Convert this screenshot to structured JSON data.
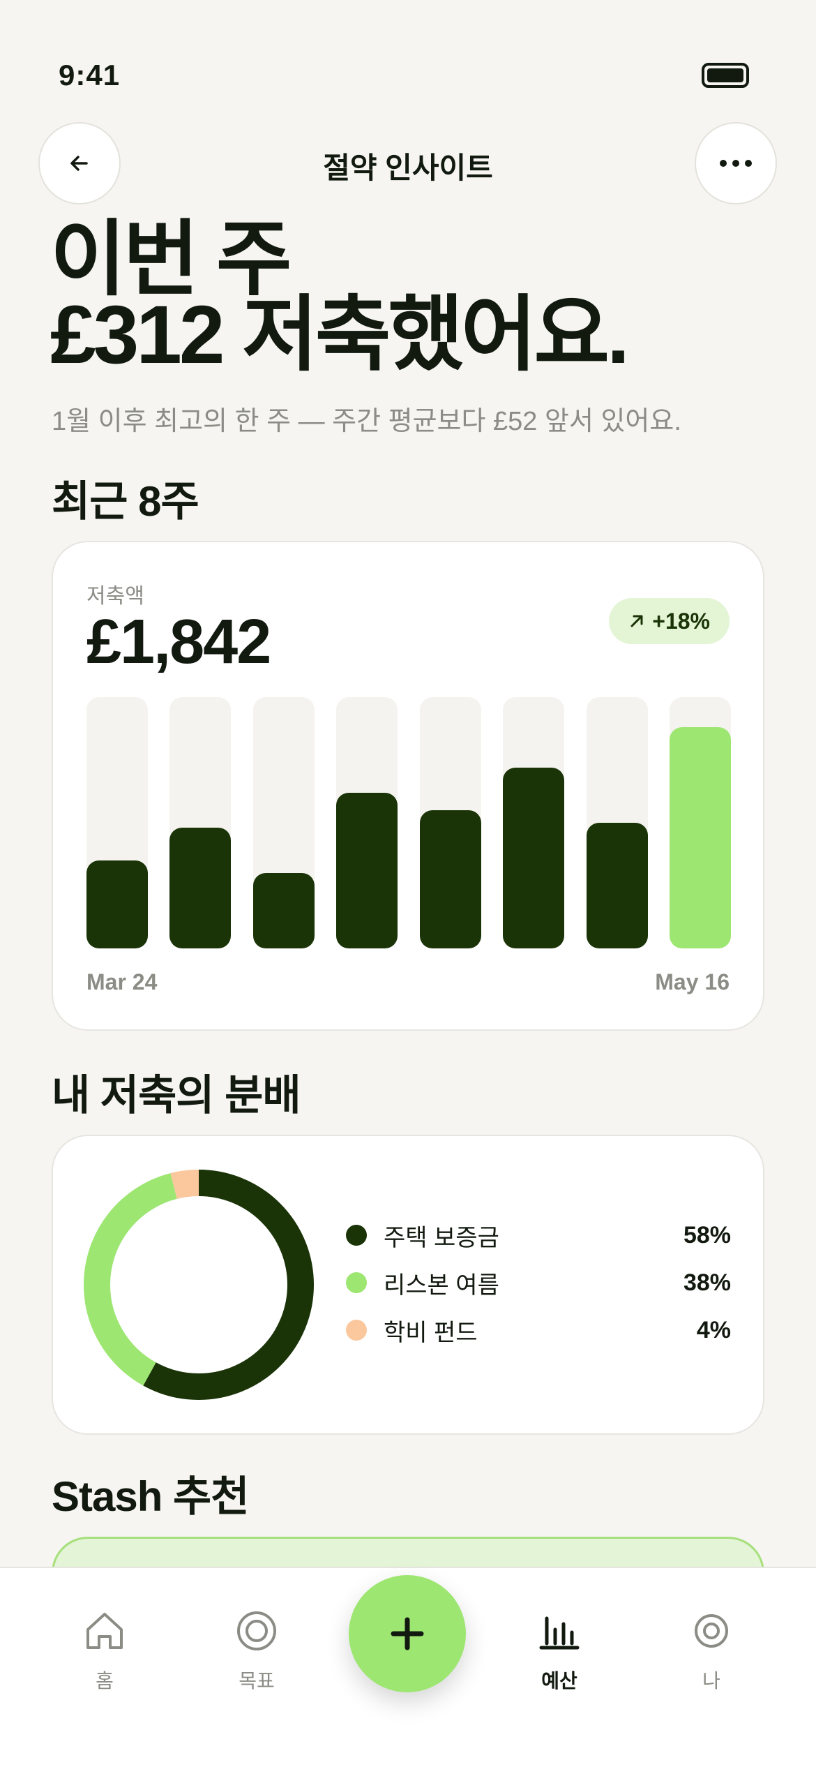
{
  "status": {
    "time": "9:41"
  },
  "nav": {
    "title": "절약 인사이트"
  },
  "hero": {
    "line1": "이번 주",
    "line2": "£312 저축했어요.",
    "subtitle": "1월 이후 최고의 한 주 — 주간 평균보다 £52 앞서 있어요."
  },
  "recent": {
    "section_title": "최근 8주",
    "metric_label": "저축액",
    "metric_value": "£1,842",
    "trend": "+18%"
  },
  "chart_data": {
    "type": "bar",
    "x_start": "Mar 24",
    "x_end": "May 16",
    "values": [
      35,
      48,
      30,
      62,
      55,
      72,
      50,
      88
    ],
    "ylim": [
      0,
      100
    ],
    "highlight_last": true,
    "colors": {
      "bar": "#1a3307",
      "current": "#9de672",
      "track": "#f4f3ef"
    }
  },
  "distribution": {
    "section_title": "내 저축의 분배",
    "items": [
      {
        "name": "주택 보증금",
        "pct_label": "58%",
        "value": 58,
        "color": "#1a3307"
      },
      {
        "name": "리스본 여름",
        "pct_label": "38%",
        "value": 38,
        "color": "#9de672"
      },
      {
        "name": "학비 펀드",
        "pct_label": "4%",
        "value": 4,
        "color": "#fbc79d"
      }
    ]
  },
  "recommend": {
    "section_title": "Stash 추천"
  },
  "tabs": [
    {
      "label": "홈",
      "icon": "home-icon"
    },
    {
      "label": "목표",
      "icon": "target-icon"
    },
    {
      "label": "예산",
      "icon": "bar-chart-icon",
      "active": true
    },
    {
      "label": "나",
      "icon": "profile-icon"
    }
  ],
  "fab": {
    "icon": "plus-icon"
  },
  "colors": {
    "accent": "#9de672",
    "dark": "#1a3307",
    "background": "#f6f5f1"
  }
}
